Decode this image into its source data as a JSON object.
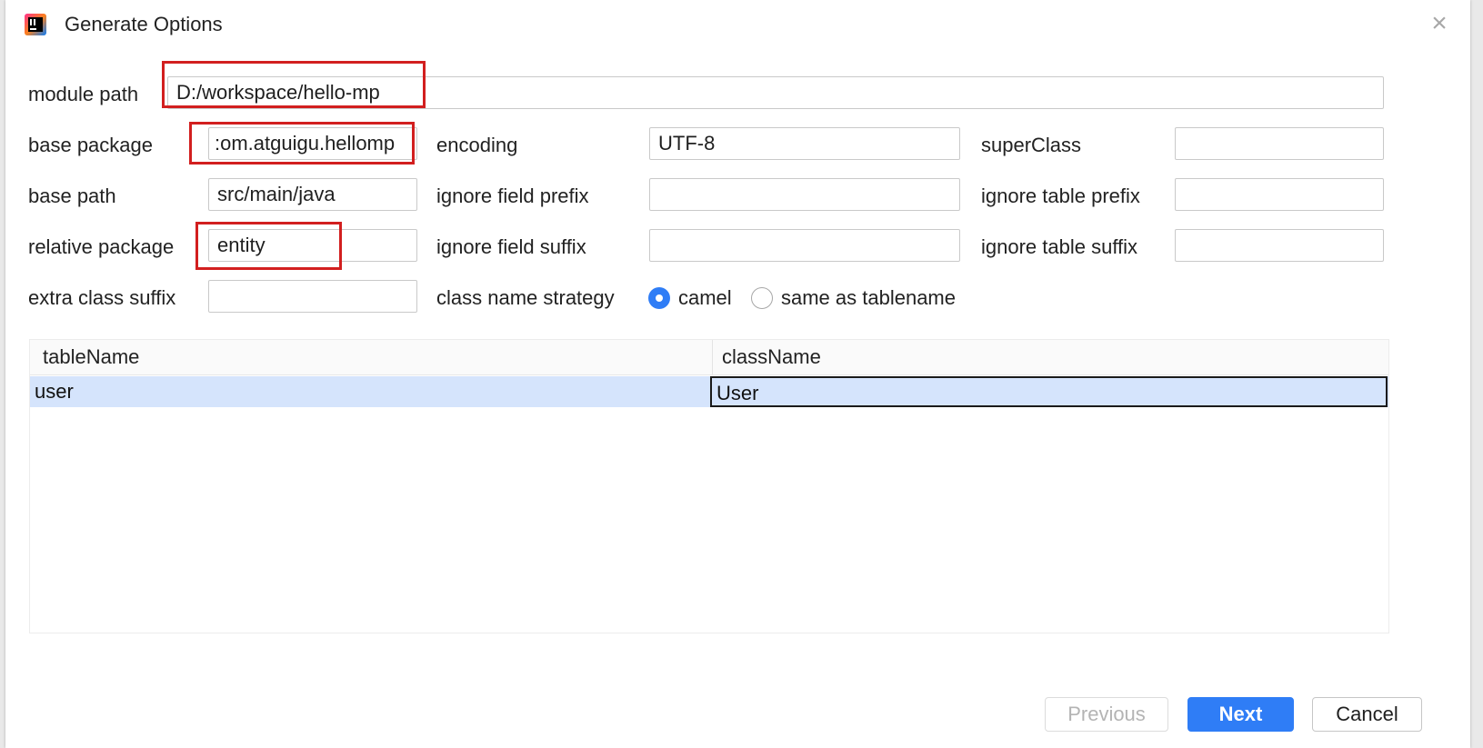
{
  "window": {
    "title": "Generate Options"
  },
  "form": {
    "module_path": {
      "label": "module path",
      "value": "D:/workspace/hello-mp"
    },
    "base_package": {
      "label": "base package",
      "value": ":om.atguigu.hellomp"
    },
    "encoding": {
      "label": "encoding",
      "value": "UTF-8"
    },
    "super_class": {
      "label": "superClass",
      "value": ""
    },
    "base_path": {
      "label": "base path",
      "value": "src/main/java"
    },
    "ignore_field_prefix": {
      "label": "ignore field prefix",
      "value": ""
    },
    "ignore_table_prefix": {
      "label": "ignore table prefix",
      "value": ""
    },
    "relative_package": {
      "label": "relative package",
      "value": "entity"
    },
    "ignore_field_suffix": {
      "label": "ignore field suffix",
      "value": ""
    },
    "ignore_table_suffix": {
      "label": "ignore table suffix",
      "value": ""
    },
    "extra_class_suffix": {
      "label": "extra class suffix",
      "value": ""
    },
    "class_name_strategy": {
      "label": "class name strategy",
      "options": [
        {
          "label": "camel",
          "selected": true
        },
        {
          "label": "same as tablename",
          "selected": false
        }
      ]
    }
  },
  "table": {
    "columns": [
      "tableName",
      "className"
    ],
    "rows": [
      {
        "tableName": "user",
        "className": "User"
      }
    ]
  },
  "buttons": {
    "previous": "Previous",
    "next": "Next",
    "cancel": "Cancel"
  },
  "colors": {
    "accent": "#2f7df6",
    "highlight_box": "#d21f1f",
    "row_selected": "#d5e4fc"
  }
}
